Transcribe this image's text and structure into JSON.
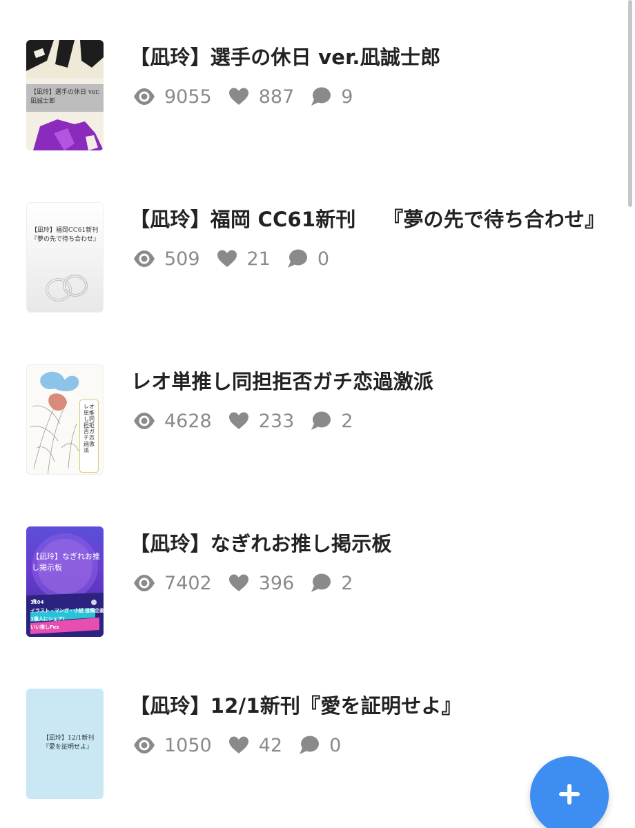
{
  "works": [
    {
      "title": "【凪玲】選手の休日 ver.凪誠士郎",
      "cover_text": "【凪玲】選手の休日 ver.\n凪誠士郎",
      "views": "9055",
      "likes": "887",
      "comments": "9"
    },
    {
      "title": "【凪玲】福岡 CC61新刊　 『夢の先で待ち合わせ』",
      "cover_text": "【凪玲】福岡CC61新刊\n『夢の先で待ち合わせ』",
      "views": "509",
      "likes": "21",
      "comments": "0"
    },
    {
      "title": "レオ単推し同担拒否ガチ恋過激派",
      "cover_text": "レオ単推し同担拒否ガチ恋過激派",
      "views": "4628",
      "likes": "233",
      "comments": "2"
    },
    {
      "title": "【凪玲】なぎれお推し掲示板",
      "cover_text": "【凪玲】なぎれお推\nし掲示板",
      "cover_badge": "1104\nイラスト・マンガ・小説 投稿企画\n1億人にシェア!\nいい推しFes",
      "views": "7402",
      "likes": "396",
      "comments": "2"
    },
    {
      "title": "【凪玲】12/1新刊『愛を証明せよ』",
      "cover_text": "【凪玲】12/1新刊\n『愛を証明せよ』",
      "views": "1050",
      "likes": "42",
      "comments": "0"
    }
  ],
  "icons": {
    "views": "eye-icon",
    "likes": "heart-icon",
    "comments": "comment-bubble-icon",
    "fab": "plus-icon"
  },
  "colors": {
    "title": "#222222",
    "stats": "#8a8a8a",
    "fab": "#3d8ef0"
  }
}
